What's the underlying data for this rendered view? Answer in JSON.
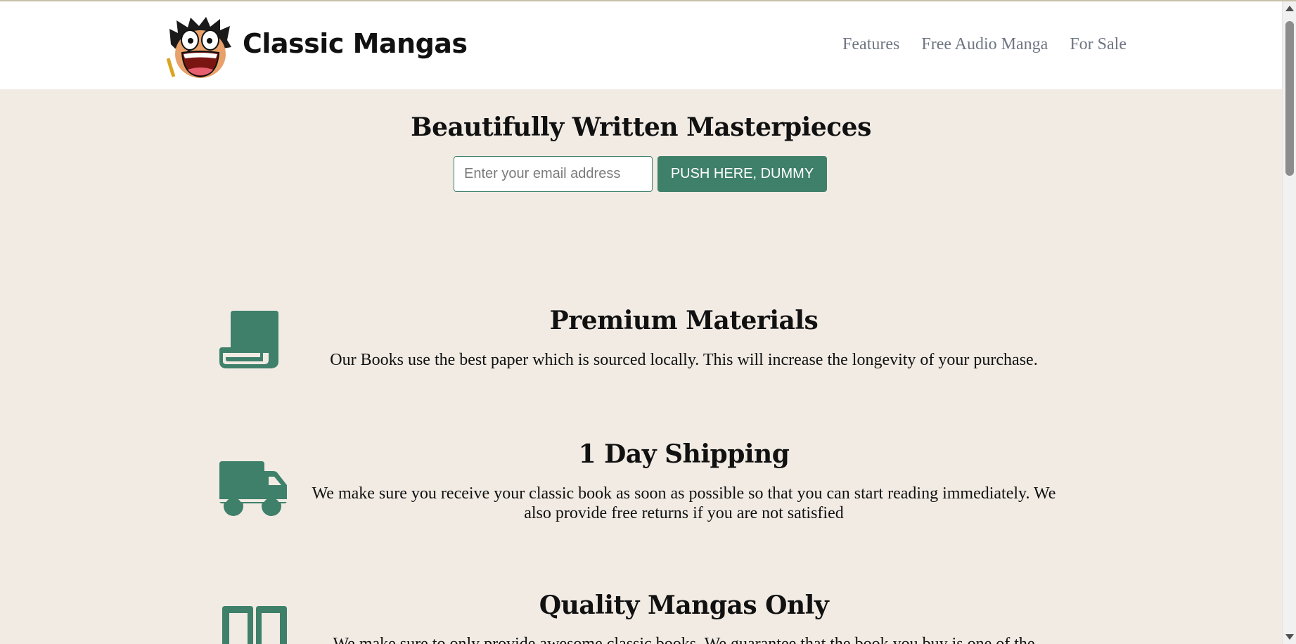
{
  "header": {
    "brand": "Classic Mangas",
    "logo_icon": "anime-character-face-logo",
    "nav": [
      {
        "label": "Features"
      },
      {
        "label": "Free Audio Manga"
      },
      {
        "label": "For Sale"
      }
    ]
  },
  "hero": {
    "title": "Beautifully Written Masterpieces",
    "email_placeholder": "Enter your email address",
    "button_label": "PUSH HERE, DUMMY"
  },
  "features": [
    {
      "icon": "scroll-icon",
      "title": "Premium Materials",
      "text": "Our Books use the best paper which is sourced locally. This will increase the longevity of your purchase."
    },
    {
      "icon": "truck-icon",
      "title": "1 Day Shipping",
      "text": "We make sure you receive your classic book as soon as possible so that you can start reading immediately. We also provide free returns if you are not satisfied"
    },
    {
      "icon": "book-open-icon",
      "title": "Quality Mangas Only",
      "text": "We make sure to only provide awesome classic books. We guarantee that the book you buy is one of the"
    }
  ],
  "colors": {
    "accent": "#3f806a",
    "background": "#f1ebe4",
    "header_bg": "#ffffff",
    "nav_text": "#6f7683"
  }
}
